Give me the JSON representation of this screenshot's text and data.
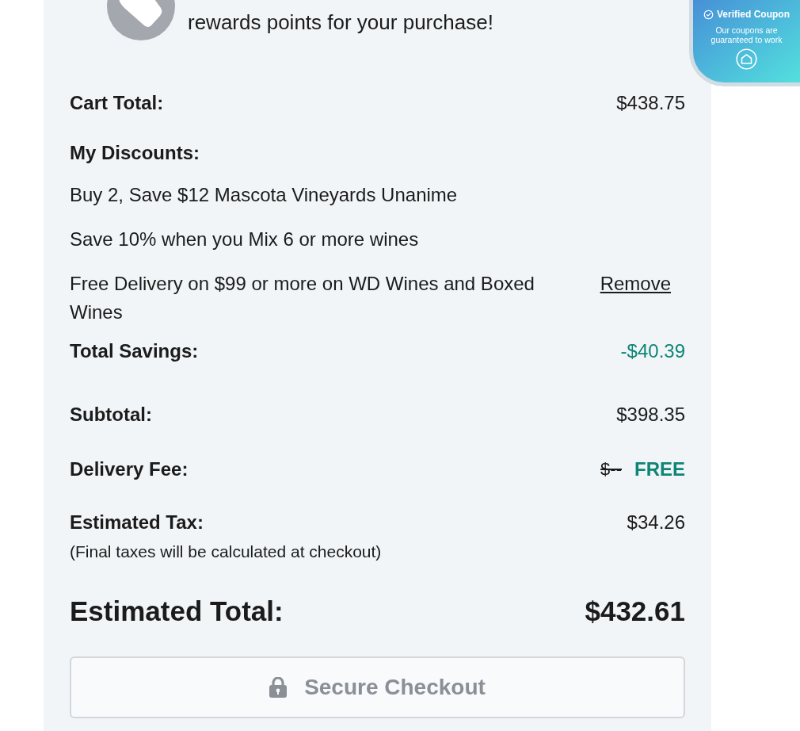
{
  "loyalty_prompt": {
    "text": "rewards points for your purchase!"
  },
  "coupon_badge": {
    "title": "Verified Coupon",
    "text": "Our coupons are guaranteed to work"
  },
  "summary": {
    "cart_total": {
      "label": "Cart Total:",
      "value": "$438.75"
    },
    "discounts": {
      "label": "My Discounts:",
      "items": [
        {
          "text": "Buy 2, Save $12 Mascota Vineyards Unanime"
        },
        {
          "text": "Save 10% when you Mix 6 or more wines"
        },
        {
          "text": "Free Delivery on $99 or more on WD Wines and Boxed Wines",
          "action": "Remove"
        }
      ]
    },
    "total_savings": {
      "label": "Total Savings:",
      "value": "-$40.39"
    },
    "subtotal": {
      "label": "Subtotal:",
      "value": "$398.35"
    },
    "delivery_fee": {
      "label": "Delivery Fee:",
      "original_value": "$--",
      "value": "FREE"
    },
    "estimated_tax": {
      "label": "Estimated Tax:",
      "value": "$34.26",
      "note": "(Final taxes will be calculated at checkout)"
    },
    "estimated_total": {
      "label": "Estimated Total:",
      "value": "$432.61"
    }
  },
  "checkout_button": {
    "label": "Secure Checkout",
    "disabled": true
  }
}
